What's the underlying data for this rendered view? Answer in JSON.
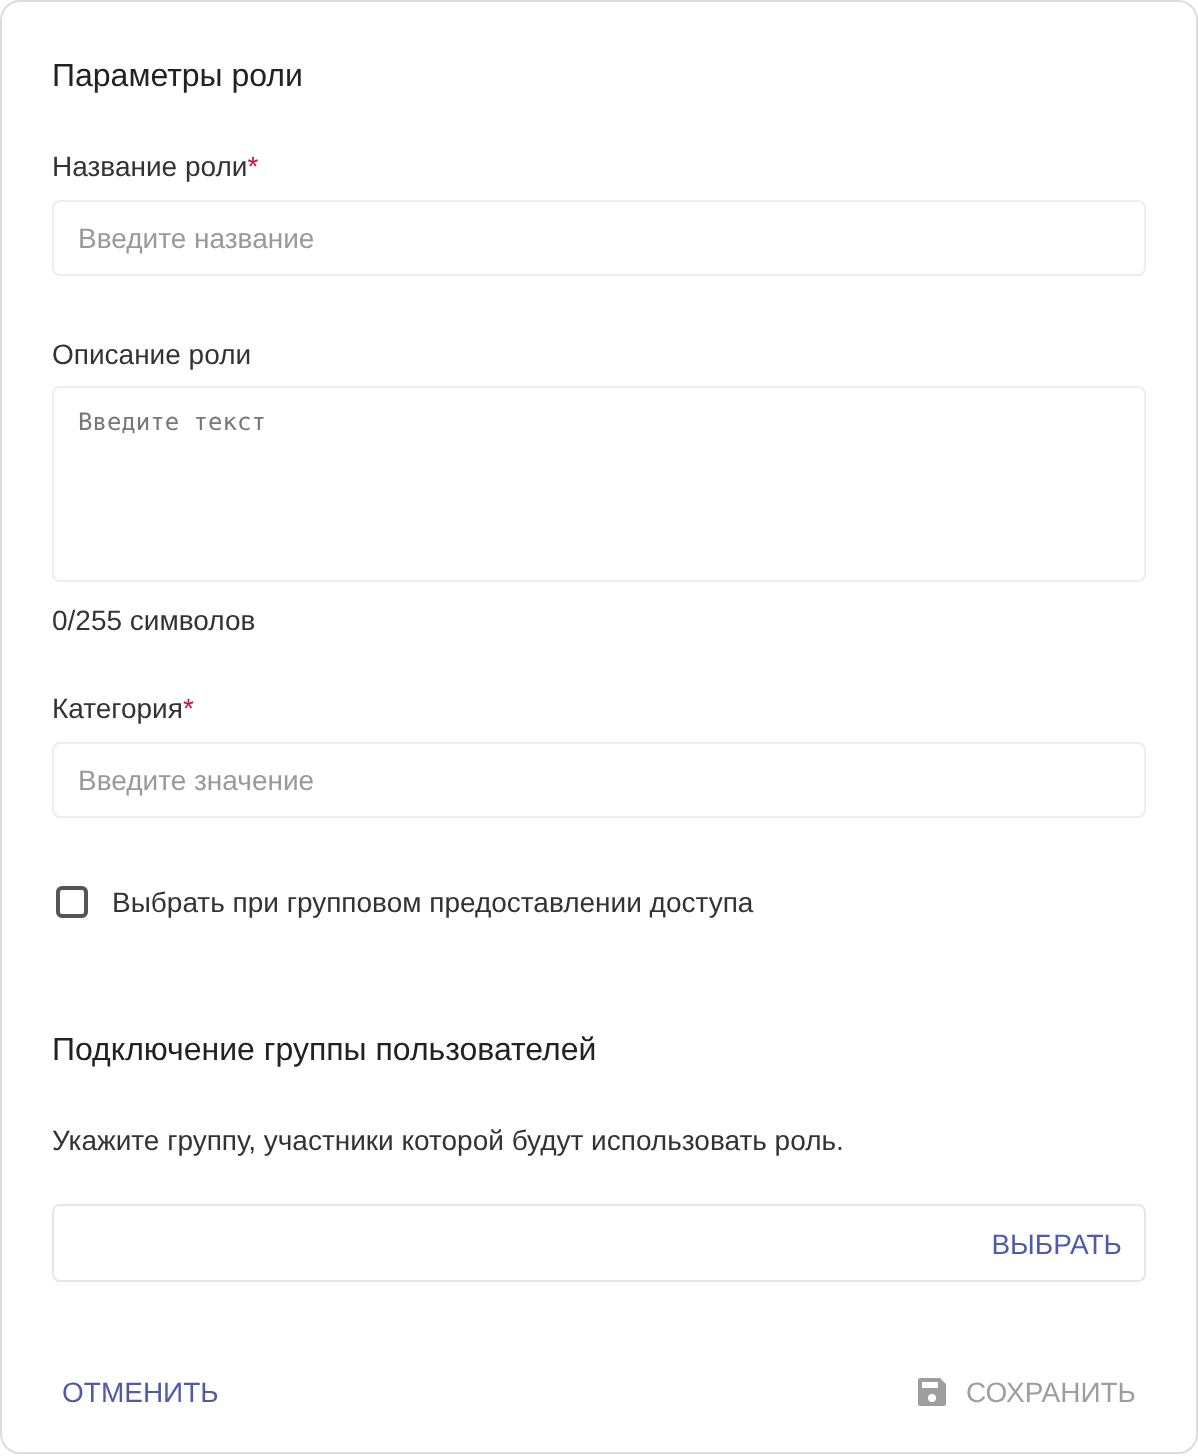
{
  "section_title": "Параметры роли",
  "fields": [
    {
      "kind": "input",
      "label": "Название роли",
      "required_mark": "*",
      "placeholder": "Введите название"
    },
    {
      "kind": "textarea",
      "label": "Описание роли",
      "placeholder": "Введите текст",
      "counter": "0/255 символов"
    },
    {
      "kind": "input",
      "label": "Категория",
      "required_mark": "*",
      "placeholder": "Введите значение"
    }
  ],
  "checkbox": {
    "label": "Выбрать при групповом предоставлении доступа",
    "checked": false
  },
  "group_section": {
    "title": "Подключение группы пользователей",
    "description": "Укажите группу, участники которой будут использовать роль.",
    "select_button": "ВЫБРАТЬ"
  },
  "footer": {
    "cancel_button": "ОТМЕНИТЬ",
    "save_button": {
      "label": "СОХРАНИТЬ",
      "disabled": true
    }
  }
}
